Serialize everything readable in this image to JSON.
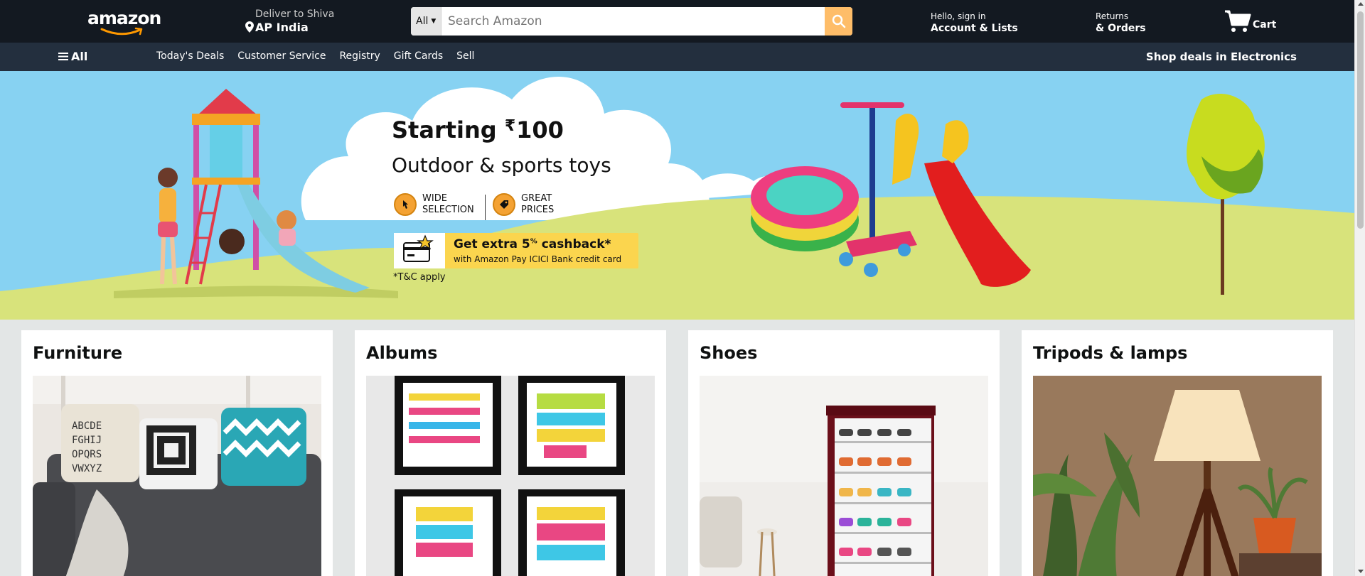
{
  "header": {
    "logo_text": "amazon",
    "deliver_line1": "Deliver to Shiva",
    "deliver_line2": "AP India",
    "search_category": "All",
    "search_placeholder": "Search Amazon",
    "account_line1": "Hello, sign in",
    "account_line2": "Account & Lists",
    "returns_line1": "Returns",
    "returns_line2": "& Orders",
    "cart_label": "Cart"
  },
  "nav": {
    "all_label": "All",
    "links": [
      "Today's Deals",
      "Customer Service",
      "Registry",
      "Gift Cards",
      "Sell"
    ],
    "promo": "Shop deals in Electronics"
  },
  "hero": {
    "title_prefix": "Starting ",
    "currency": "₹",
    "price": "100",
    "subtitle": "Outdoor & sports toys",
    "features": [
      {
        "line1": "WIDE",
        "line2": "SELECTION",
        "icon": "pointer-icon"
      },
      {
        "line1": "GREAT",
        "line2": "PRICES",
        "icon": "price-tag-icon"
      }
    ],
    "cashback_main": "Get extra 5",
    "cashback_pct": "%",
    "cashback_suffix": " cashback*",
    "cashback_sub": "with Amazon Pay ICICI Bank credit card",
    "terms": "*T&C apply"
  },
  "cards": [
    {
      "title": "Furniture"
    },
    {
      "title": "Albums"
    },
    {
      "title": "Shoes"
    },
    {
      "title": "Tripods & lamps"
    }
  ],
  "colors": {
    "header_bg": "#131921",
    "nav_bg": "#232f3e",
    "search_button": "#febd69",
    "hero_bg": "#87d2f2",
    "page_bg": "#e3e6e6",
    "cashback_bg": "#fbd54e"
  }
}
